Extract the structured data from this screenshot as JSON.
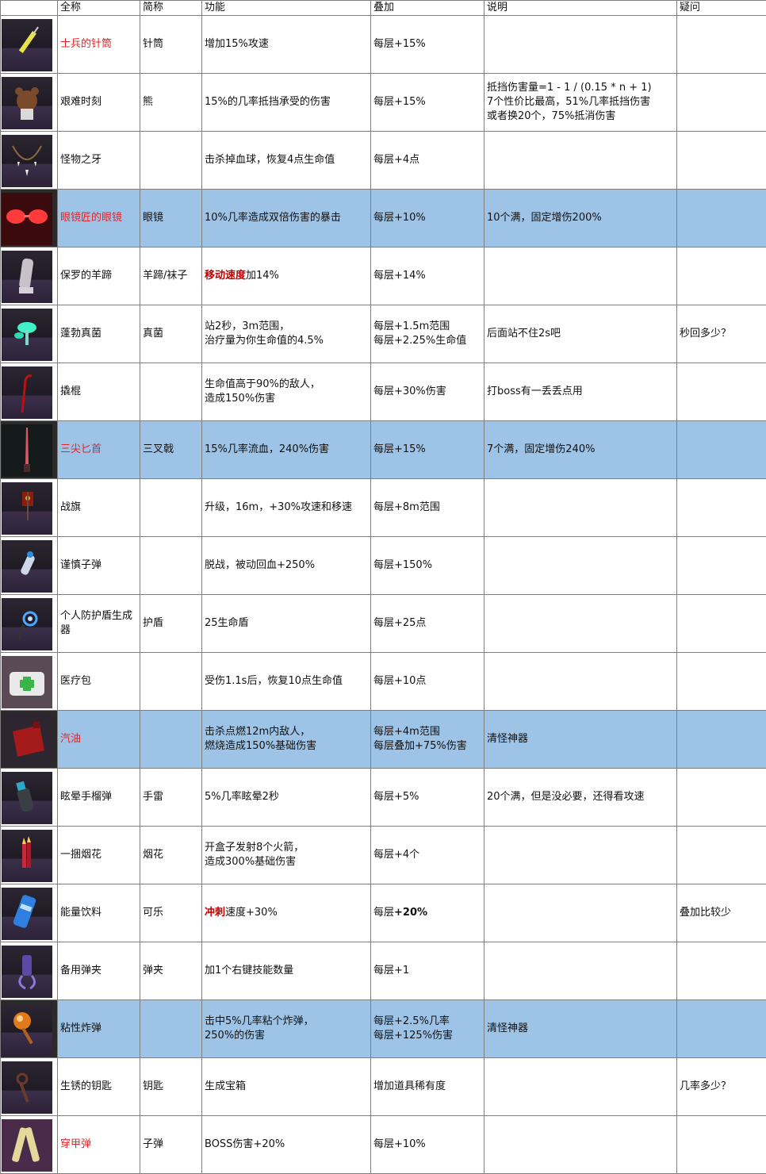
{
  "headers": [
    "",
    "全称",
    "简称",
    "功能",
    "叠加",
    "说明",
    "疑问"
  ],
  "rows": [
    {
      "icon": "syringe-item-icon",
      "name": "士兵的针筒",
      "name_red": true,
      "short": "针筒",
      "func": [
        {
          "t": "增加15%攻速"
        }
      ],
      "stack": [
        "每层+15%"
      ],
      "note": [],
      "question": "",
      "highlight": false
    },
    {
      "icon": "teddy-bear-item-icon",
      "name": "艰难时刻",
      "name_red": false,
      "short": "熊",
      "func": [
        {
          "t": "15%的几率抵挡承受的伤害"
        }
      ],
      "stack": [
        "每层+15%"
      ],
      "note": [
        "抵挡伤害量=1 - 1 / (0.15 * n + 1)",
        "7个性价比最高，51%几率抵挡伤害",
        "或者换20个，75%抵消伤害"
      ],
      "question": "",
      "highlight": false
    },
    {
      "icon": "monster-tooth-necklace-icon",
      "name": "怪物之牙",
      "name_red": false,
      "short": "",
      "func": [
        {
          "t": "击杀掉血球，恢复4点生命值"
        }
      ],
      "stack": [
        "每层+4点"
      ],
      "note": [],
      "question": "",
      "highlight": false
    },
    {
      "icon": "red-glasses-item-icon",
      "name": "眼镜匠的眼镜",
      "name_red": true,
      "short": "眼镜",
      "func": [
        {
          "t": "10%几率造成双倍伤害的暴击"
        }
      ],
      "stack": [
        "每层+10%"
      ],
      "note": [
        "10个满，固定增伤200%"
      ],
      "question": "",
      "highlight": true
    },
    {
      "icon": "goat-hoof-item-icon",
      "name": "保罗的羊蹄",
      "name_red": false,
      "short": "羊蹄/袜子",
      "func": [
        {
          "t": "移动速度",
          "style": "bold-red"
        },
        {
          "t": "加14%"
        }
      ],
      "stack": [
        "每层+14%"
      ],
      "note": [],
      "question": "",
      "highlight": false
    },
    {
      "icon": "mushroom-item-icon",
      "name": "蓬勃真菌",
      "name_red": false,
      "short": "真菌",
      "func": [
        {
          "t": "站2秒，3m范围，",
          "br": true
        },
        {
          "t": "治疗量为你生命值的4.5%"
        }
      ],
      "stack": [
        "每层+1.5m范围",
        "每层+2.25%生命值"
      ],
      "note": [
        "后面站不住2s吧"
      ],
      "question": "秒回多少？",
      "highlight": false
    },
    {
      "icon": "crowbar-item-icon",
      "name": "撬棍",
      "name_red": false,
      "short": "",
      "func": [
        {
          "t": "生命值高于90%的敌人，",
          "br": true
        },
        {
          "t": "造成150%伤害"
        }
      ],
      "stack": [
        "每层+30%伤害"
      ],
      "note": [
        "打boss有一丢丢点用"
      ],
      "question": "",
      "highlight": false
    },
    {
      "icon": "tri-tip-dagger-icon",
      "name": "三尖匕首",
      "name_red": true,
      "short": "三叉戟",
      "func": [
        {
          "t": "15%几率流血，240%伤害"
        }
      ],
      "stack": [
        "每层+15%"
      ],
      "note": [
        "7个满，固定增伤240%"
      ],
      "question": "",
      "highlight": true
    },
    {
      "icon": "war-banner-item-icon",
      "name": "战旗",
      "name_red": false,
      "short": "",
      "func": [
        {
          "t": "升级，16m，+30%攻速和移速"
        }
      ],
      "stack": [
        "每层+8m范围"
      ],
      "note": [],
      "question": "",
      "highlight": false
    },
    {
      "icon": "cautious-slug-item-icon",
      "name": "谨慎子弹",
      "name_red": false,
      "short": "",
      "func": [
        {
          "t": "脱战，被动回血+250%"
        }
      ],
      "stack": [
        "每层+150%"
      ],
      "note": [],
      "question": "",
      "highlight": false
    },
    {
      "icon": "shield-generator-item-icon",
      "name": "个人防护盾生成器",
      "name_red": false,
      "short": "护盾",
      "func": [
        {
          "t": "25生命盾"
        }
      ],
      "stack": [
        "每层+25点"
      ],
      "note": [],
      "question": "",
      "highlight": false
    },
    {
      "icon": "medkit-item-icon",
      "name": "医疗包",
      "name_red": false,
      "short": "",
      "func": [
        {
          "t": "受伤1.1s后，恢复10点生命值"
        }
      ],
      "stack": [
        "每层+10点"
      ],
      "note": [],
      "question": "",
      "highlight": false
    },
    {
      "icon": "gasoline-can-icon",
      "name": "汽油",
      "name_red": true,
      "short": "",
      "func": [
        {
          "t": "击杀点燃12m内敌人，",
          "br": true
        },
        {
          "t": "燃烧造成150%基础伤害"
        }
      ],
      "stack": [
        "每层+4m范围",
        "每层叠加+75%伤害"
      ],
      "note": [
        "清怪神器"
      ],
      "question": "",
      "highlight": true
    },
    {
      "icon": "stun-grenade-item-icon",
      "name": "眩晕手榴弹",
      "name_red": false,
      "short": "手雷",
      "func": [
        {
          "t": "5%几率眩晕2秒"
        }
      ],
      "stack": [
        "每层+5%"
      ],
      "note": [
        "20个满，但是没必要，还得看攻速"
      ],
      "question": "",
      "highlight": false
    },
    {
      "icon": "firework-bundle-icon",
      "name": "一捆烟花",
      "name_red": false,
      "short": "烟花",
      "func": [
        {
          "t": "开盒子发射8个火箭，",
          "br": true
        },
        {
          "t": "造成300%基础伤害"
        }
      ],
      "stack": [
        "每层+4个"
      ],
      "note": [],
      "question": "",
      "highlight": false
    },
    {
      "icon": "energy-drink-can-icon",
      "name": "能量饮料",
      "name_red": false,
      "short": "可乐",
      "func": [
        {
          "t": "冲刺",
          "style": "bold-red"
        },
        {
          "t": "速度+30%"
        }
      ],
      "stack_rich": [
        {
          "t": "每层"
        },
        {
          "t": "+20%",
          "style": "bold"
        }
      ],
      "stack": [],
      "note": [],
      "question": "叠加比较少",
      "highlight": false
    },
    {
      "icon": "backup-magazine-icon",
      "name": "备用弹夹",
      "name_red": false,
      "short": "弹夹",
      "func": [
        {
          "t": "加1个右键技能数量"
        }
      ],
      "stack": [
        "每层+1"
      ],
      "note": [],
      "question": "",
      "highlight": false
    },
    {
      "icon": "sticky-bomb-item-icon",
      "name": "粘性炸弹",
      "name_red": false,
      "short": "",
      "func": [
        {
          "t": "击中5%几率粘个炸弹，",
          "br": true
        },
        {
          "t": "250%的伤害"
        }
      ],
      "stack": [
        "每层+2.5%几率",
        "每层+125%伤害"
      ],
      "note": [
        "清怪神器"
      ],
      "question": "",
      "highlight": true
    },
    {
      "icon": "rusty-key-item-icon",
      "name": "生锈的钥匙",
      "name_red": false,
      "short": "钥匙",
      "func": [
        {
          "t": "生成宝箱"
        }
      ],
      "stack": [
        "增加道具稀有度"
      ],
      "note": [],
      "question": "几率多少？",
      "highlight": false
    },
    {
      "icon": "armor-piercing-rounds-icon",
      "name": "穿甲弹",
      "name_red": true,
      "short": "子弹",
      "func": [
        {
          "t": "BOSS伤害+20%"
        }
      ],
      "stack": [
        "每层+10%"
      ],
      "note": [],
      "question": "",
      "highlight": false
    }
  ]
}
